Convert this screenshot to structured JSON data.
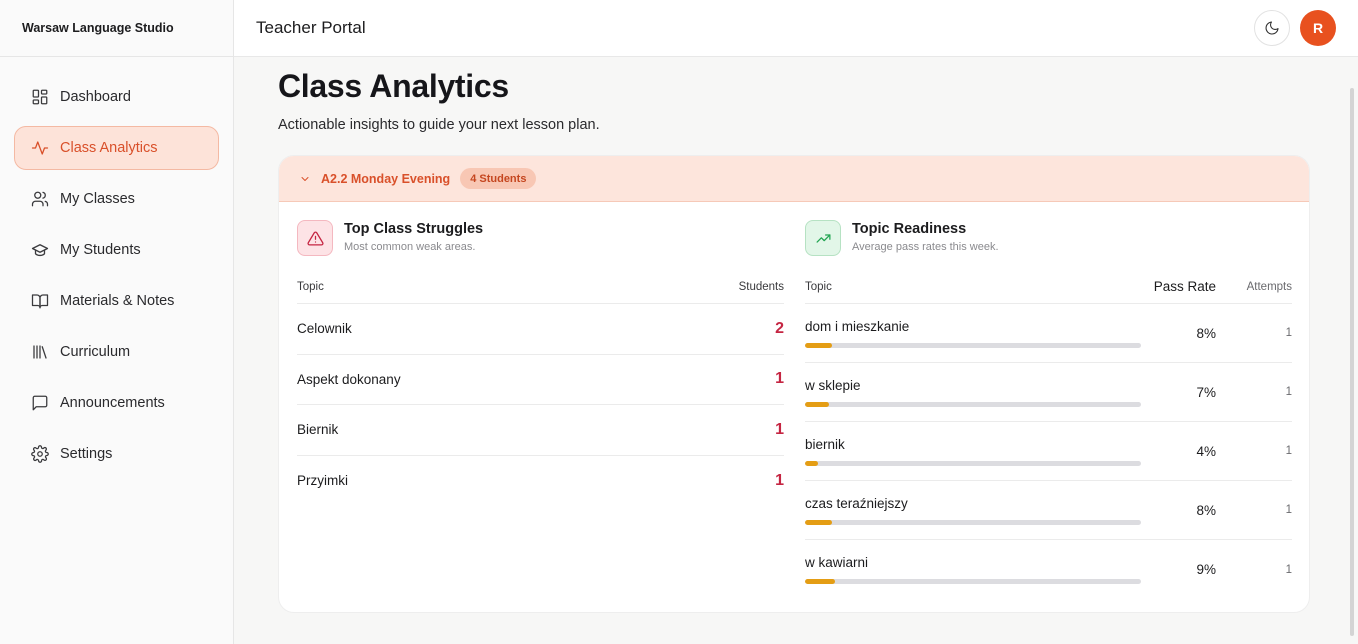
{
  "brand": "Warsaw Language Studio",
  "header": {
    "title": "Teacher Portal",
    "avatar_initial": "R"
  },
  "nav": [
    {
      "label": "Dashboard",
      "icon": "dashboard-icon"
    },
    {
      "label": "Class Analytics",
      "icon": "activity-icon",
      "active": true
    },
    {
      "label": "My Classes",
      "icon": "users-icon"
    },
    {
      "label": "My Students",
      "icon": "graduation-cap-icon"
    },
    {
      "label": "Materials & Notes",
      "icon": "book-open-icon"
    },
    {
      "label": "Curriculum",
      "icon": "library-icon"
    },
    {
      "label": "Announcements",
      "icon": "message-square-icon"
    },
    {
      "label": "Settings",
      "icon": "gear-icon"
    }
  ],
  "page": {
    "title": "Class Analytics",
    "subtitle": "Actionable insights to guide your next lesson plan."
  },
  "class_card": {
    "name": "A2.2 Monday Evening",
    "badge": "4 Students"
  },
  "struggles": {
    "title": "Top Class Struggles",
    "subtitle": "Most common weak areas.",
    "col_topic": "Topic",
    "col_students": "Students",
    "rows": [
      {
        "topic": "Celownik",
        "count": "2"
      },
      {
        "topic": "Aspekt dokonany",
        "count": "1"
      },
      {
        "topic": "Biernik",
        "count": "1"
      },
      {
        "topic": "Przyimki",
        "count": "1"
      }
    ]
  },
  "readiness": {
    "title": "Topic Readiness",
    "subtitle": "Average pass rates this week.",
    "col_topic": "Topic",
    "col_rate": "Pass Rate",
    "col_attempts": "Attempts",
    "rows": [
      {
        "topic": "dom i mieszkanie",
        "rate": "8%",
        "rate_value": 8,
        "attempts": "1"
      },
      {
        "topic": "w sklepie",
        "rate": "7%",
        "rate_value": 7,
        "attempts": "1"
      },
      {
        "topic": "biernik",
        "rate": "4%",
        "rate_value": 4,
        "attempts": "1"
      },
      {
        "topic": "czas teraźniejszy",
        "rate": "8%",
        "rate_value": 8,
        "attempts": "1"
      },
      {
        "topic": "w kawiarni",
        "rate": "9%",
        "rate_value": 9,
        "attempts": "1"
      }
    ]
  },
  "colors": {
    "accent": "#e8511f",
    "active_nav_bg": "#fde3d9",
    "struggle_count": "#c52542",
    "bar_fill": "#e49d14",
    "bar_track": "#dcdce0"
  }
}
